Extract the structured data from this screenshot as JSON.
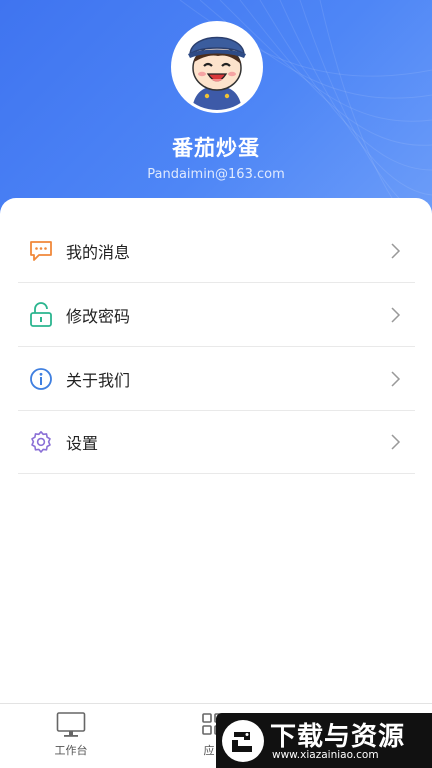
{
  "profile": {
    "name": "番茄炒蛋",
    "email": "Pandaimin@163.com",
    "avatar_icon": "cartoon-boy-avatar"
  },
  "menu": [
    {
      "label": "我的消息",
      "icon": "message-icon",
      "color": "#f0883a"
    },
    {
      "label": "修改密码",
      "icon": "lock-icon",
      "color": "#2bb58f"
    },
    {
      "label": "关于我们",
      "icon": "info-icon",
      "color": "#3f7fe0"
    },
    {
      "label": "设置",
      "icon": "settings-icon",
      "color": "#8a6fd6"
    }
  ],
  "tabbar": {
    "tabs": [
      {
        "label": "工作台",
        "icon": "monitor-icon"
      },
      {
        "label": "应",
        "icon": "grid-icon"
      }
    ]
  },
  "watermark": {
    "title": "下载与资源",
    "url": "www.xiazainiao.com"
  },
  "colors": {
    "header_start": "#3f74f0",
    "header_end": "#6f9ff9"
  }
}
